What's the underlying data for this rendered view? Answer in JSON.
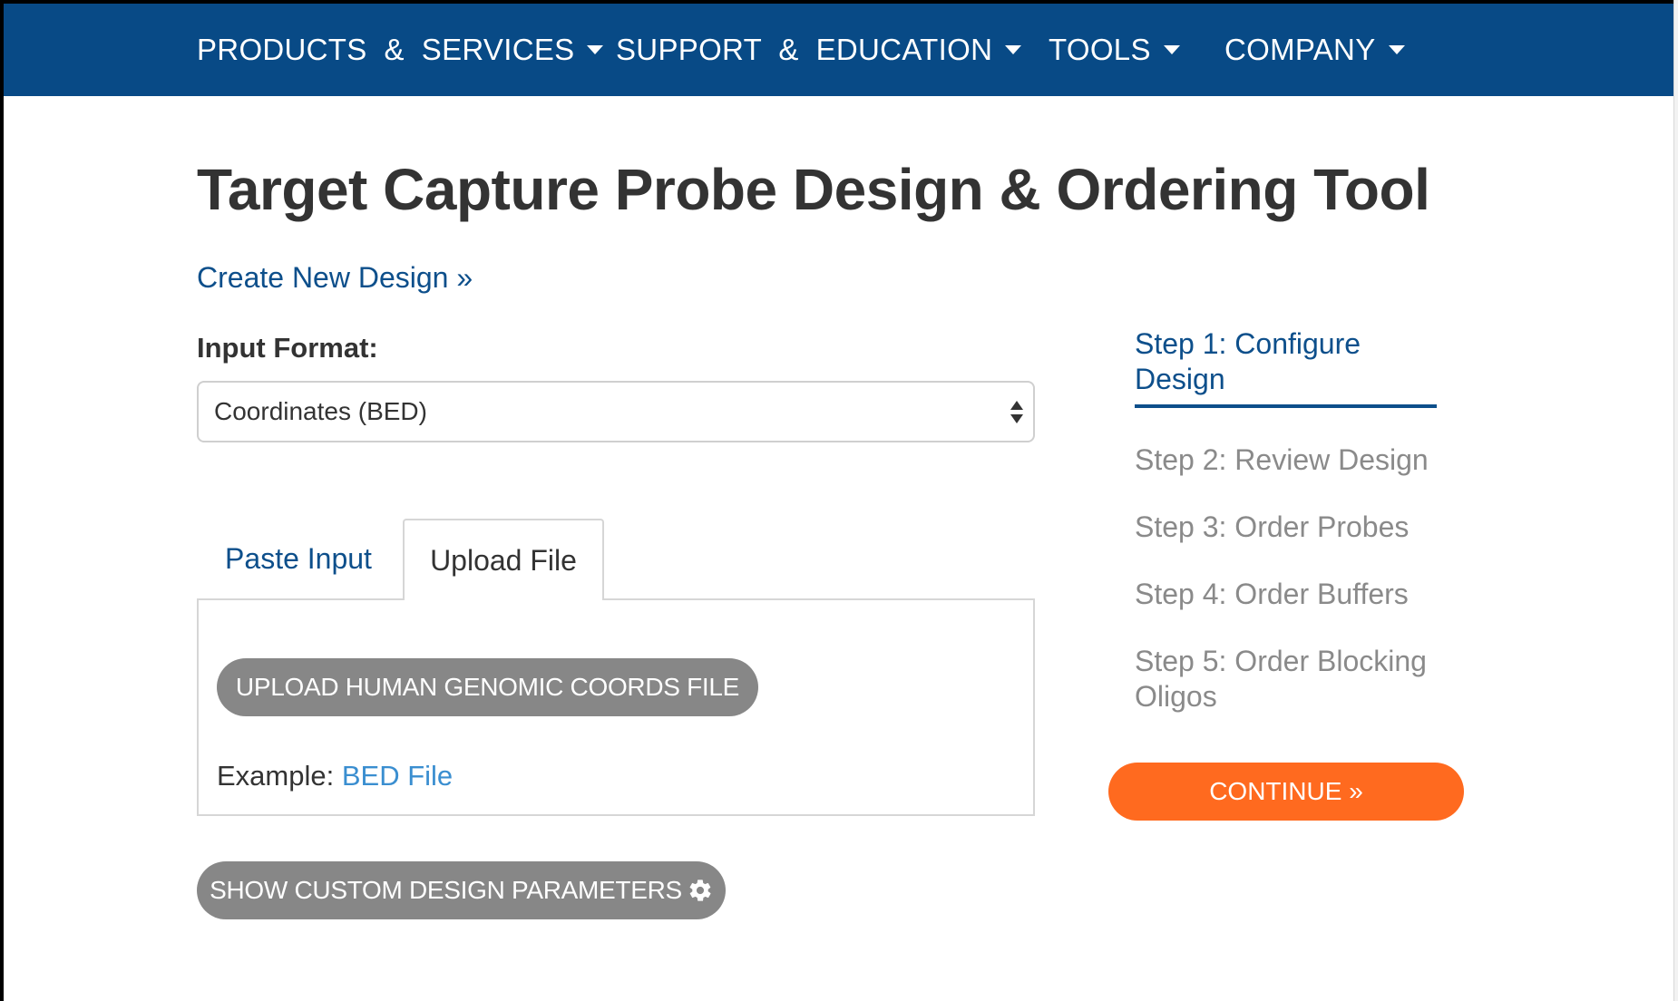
{
  "nav": {
    "items": [
      {
        "label": "PRODUCTS  &  SERVICES"
      },
      {
        "label": "SUPPORT  &  EDUCATION"
      },
      {
        "label": "TOOLS"
      },
      {
        "label": "COMPANY"
      }
    ]
  },
  "page": {
    "title": "Target Capture Probe Design & Ordering Tool",
    "create_link": "Create New Design »"
  },
  "form": {
    "input_format_label": "Input Format:",
    "input_format_value": "Coordinates (BED)",
    "tabs": [
      {
        "label": "Paste Input",
        "active": false
      },
      {
        "label": "Upload File",
        "active": true
      }
    ],
    "upload_button": "UPLOAD HUMAN GENOMIC COORDS FILE",
    "example_prefix": "Example: ",
    "example_link": "BED File",
    "params_button": "SHOW CUSTOM DESIGN PARAMETERS"
  },
  "steps": {
    "items": [
      {
        "label": "Step 1: Configure Design",
        "active": true
      },
      {
        "label": "Step 2: Review Design",
        "active": false
      },
      {
        "label": "Step 3: Order Probes",
        "active": false
      },
      {
        "label": "Step 4: Order Buffers",
        "active": false
      },
      {
        "label": "Step 5: Order Blocking Oligos",
        "active": false
      }
    ],
    "continue_button": "CONTINUE »"
  },
  "icons": {
    "nav_caret": "caret-down-icon",
    "select": "select-arrows-icon",
    "params": "gear-icon"
  },
  "colors": {
    "nav_bg": "#084a86",
    "link": "#0d4f8b",
    "example_link": "#3a8ed0",
    "gray_button": "#878787",
    "continue": "#ff6a1f",
    "inactive_step": "#8a8a8a"
  }
}
